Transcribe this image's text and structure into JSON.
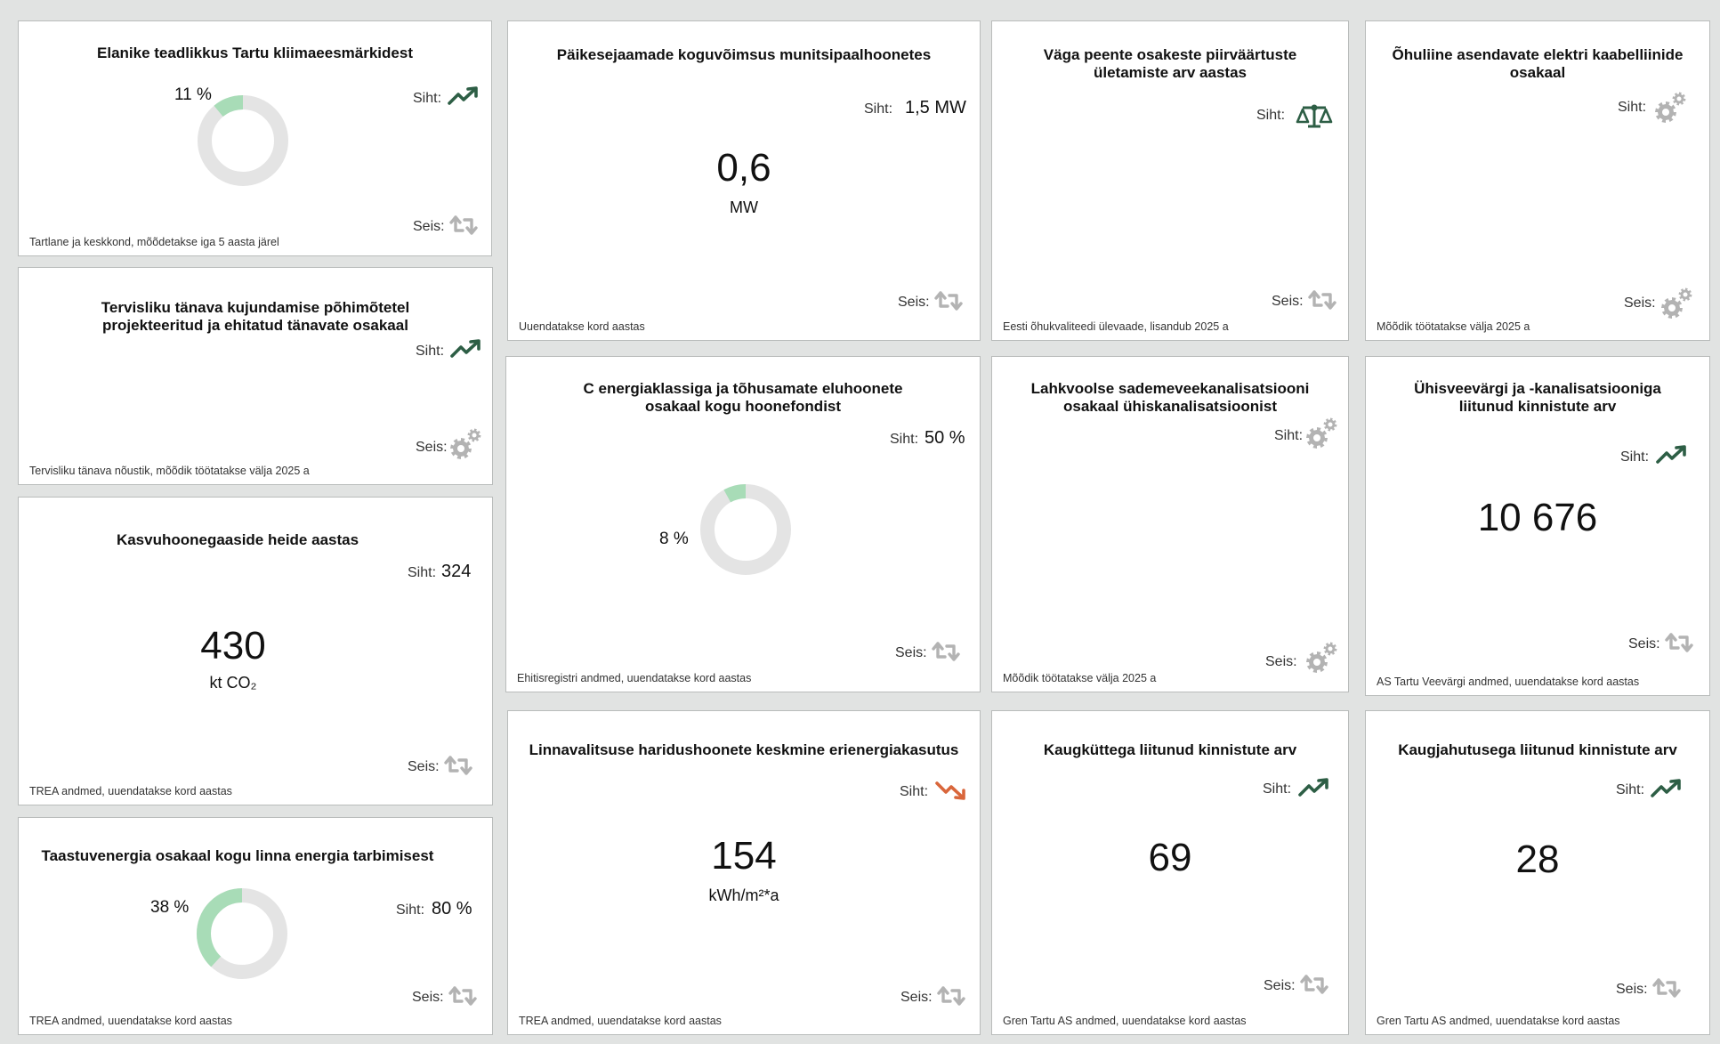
{
  "colors": {
    "accent_green": "#2d5e45",
    "donut_fill": "#a8dcb7",
    "donut_track": "#e4e4e4",
    "trend_down": "#d9663b",
    "muted_icon": "#b3b3b3"
  },
  "labels": {
    "target": "Siht:",
    "status": "Seis:"
  },
  "icons": {
    "trend_up": "trend-up-icon",
    "trend_down": "trend-down-icon",
    "balance": "balance-scale-icon",
    "gear": "gear-icon",
    "refresh": "refresh-icon"
  },
  "cards": [
    {
      "title": "Elanike teadlikkus Tartu kliimaeesmärkidest",
      "value": "11 %",
      "percent": 11,
      "target_icon": "trend-up",
      "status_icon": "refresh",
      "footer": "Tartlane ja keskkond, mõõdetakse iga 5 aasta järel"
    },
    {
      "title": "Tervisliku tänava kujundamise põhimõtetel projekteeritud ja ehitatud tänavate osakaal",
      "target_icon": "trend-up",
      "status_icon": "gear",
      "footer": "Tervisliku tänava nõustik, mõõdik töötatakse välja 2025 a"
    },
    {
      "title": "Kasvuhoonegaaside heide aastas",
      "target": "324",
      "value": "430",
      "unit": "kt CO₂",
      "status_icon": "refresh",
      "footer": "TREA andmed, uuendatakse kord aastas"
    },
    {
      "title": "Taastuvenergia osakaal kogu linna energia tarbimisest",
      "value": "38 %",
      "percent": 38,
      "target": "80 %",
      "status_icon": "refresh",
      "footer": "TREA andmed, uuendatakse kord aastas"
    },
    {
      "title": "Päikesejaamade koguvõimsus munitsipaalhoonetes",
      "target": "1,5 MW",
      "value": "0,6",
      "unit": "MW",
      "status_icon": "refresh",
      "footer": "Uuendatakse kord aastas"
    },
    {
      "title": "C energiaklassiga ja tõhusamate eluhoonete osakaal kogu hoonefondist",
      "target": "50 %",
      "value": "8 %",
      "percent": 8,
      "status_icon": "refresh",
      "footer": "Ehitisregistri andmed, uuendatakse kord aastas"
    },
    {
      "title": "Linnavalitsuse haridushoonete keskmine erienergiakasutus",
      "target_icon": "trend-down",
      "value": "154",
      "unit": "kWh/m²*a",
      "status_icon": "refresh",
      "footer": "TREA andmed, uuendatakse kord aastas"
    },
    {
      "title": "Väga peente osakeste piirväärtuste ületamiste arv aastas",
      "target_icon": "balance",
      "status_icon": "refresh",
      "footer": "Eesti õhukvaliteedi ülevaade, lisandub 2025 a"
    },
    {
      "title": "Lahkvoolse sademeveekanalisatsiooni osakaal ühiskanalisatsioonist",
      "target_icon": "gear",
      "status_icon": "gear",
      "footer": "Mõõdik töötatakse välja 2025 a"
    },
    {
      "title": "Kaugküttega liitunud kinnistute arv",
      "target_icon": "trend-up",
      "value": "69",
      "status_icon": "refresh",
      "footer": "Gren Tartu AS andmed, uuendatakse kord aastas"
    },
    {
      "title": "Õhuliine asendavate elektri kaabelliinide osakaal",
      "target_icon": "gear",
      "status_icon": "gear",
      "footer": "Mõõdik töötatakse välja 2025 a"
    },
    {
      "title": "Ühisveevärgi ja -kanalisatsiooniga liitunud kinnistute arv",
      "target_icon": "trend-up",
      "value": "10 676",
      "status_icon": "refresh",
      "footer": "AS Tartu Veevärgi andmed, uuendatakse kord aastas"
    },
    {
      "title": "Kaugjahutusega liitunud kinnistute arv",
      "target_icon": "trend-up",
      "value": "28",
      "status_icon": "refresh",
      "footer": "Gren Tartu AS andmed, uuendatakse kord aastas"
    }
  ]
}
